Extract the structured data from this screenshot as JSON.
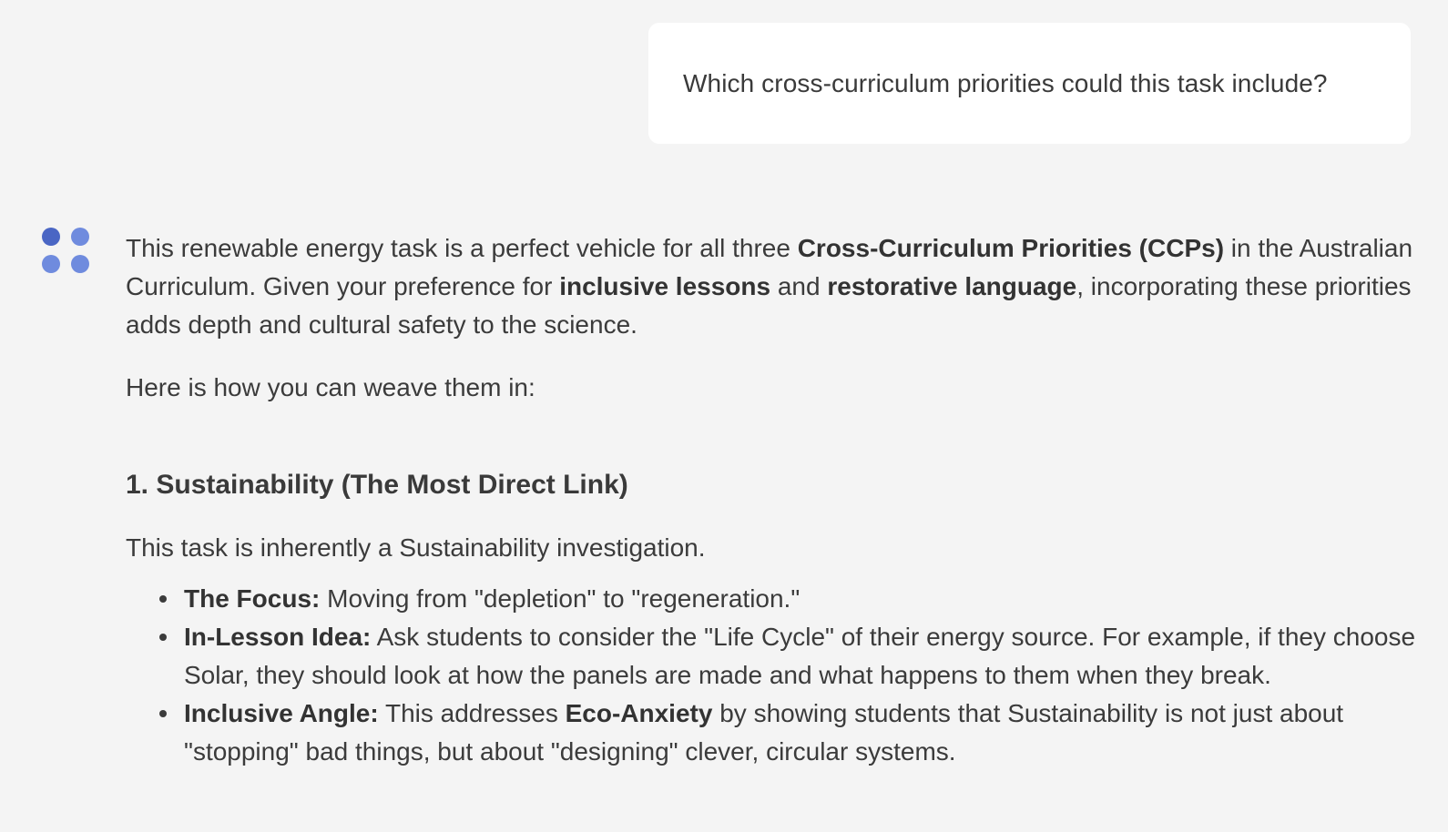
{
  "user_message": "Which cross-curriculum priorities could this task include?",
  "avatar": {
    "icon": "assistant-dots-icon",
    "colors": [
      "#4a66c4",
      "#6f8bde",
      "#6f8bde",
      "#6f8bde"
    ]
  },
  "response": {
    "intro": {
      "t1": "This renewable energy task is a perfect vehicle for all three ",
      "b1": "Cross-Curriculum Priorities (CCPs)",
      "t2": " in the Australian Curriculum. Given your preference for ",
      "b2": "inclusive lessons",
      "t3": " and ",
      "b3": "restorative language",
      "t4": ", incorporating these priorities adds depth and cultural safety to the science."
    },
    "lead_in": "Here is how you can weave them in:",
    "section": {
      "heading": "1. Sustainability (The Most Direct Link)",
      "description": "This task is inherently a Sustainability investigation.",
      "points": [
        {
          "label": "The Focus:",
          "text": " Moving from \"depletion\" to \"regeneration.\""
        },
        {
          "label": "In-Lesson Idea:",
          "text": " Ask students to consider the \"Life Cycle\" of their energy source. For example, if they choose Solar, they should look at how the panels are made and what happens to them when they break."
        },
        {
          "label": "Inclusive Angle:",
          "t1": " This addresses ",
          "b1": "Eco-Anxiety",
          "t2": " by showing students that Sustainability is not just about \"stopping\" bad things, but about \"designing\" clever, circular systems."
        }
      ]
    }
  }
}
